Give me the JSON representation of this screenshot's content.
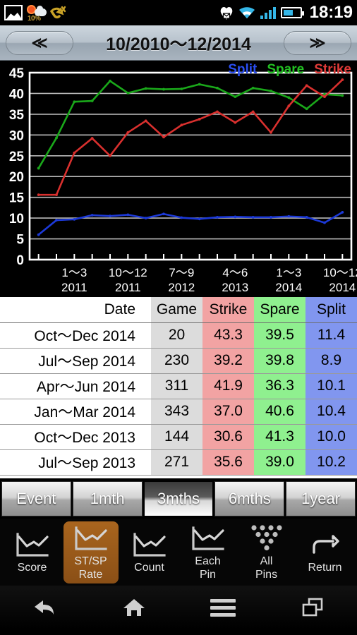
{
  "statusbar": {
    "time": "18:19",
    "weather_percent": "10%",
    "icons": [
      "gallery-icon",
      "weather-icon",
      "missed-call-icon",
      "message-heart-icon",
      "wifi-icon",
      "signal-icon",
      "battery-icon"
    ]
  },
  "titlebar": {
    "prev_label": "≪",
    "title": "10/2010～12/2014",
    "next_label": "≫"
  },
  "chart_data": {
    "type": "line",
    "title": "",
    "xlabel": "",
    "ylabel": "",
    "ylim": [
      0,
      45
    ],
    "yticks": [
      0,
      5,
      10,
      15,
      20,
      25,
      30,
      35,
      40,
      45
    ],
    "grid": true,
    "legend_position": "top-right",
    "xtick_labels": [
      {
        "index": 2,
        "line1": "1～3",
        "line2": "2011"
      },
      {
        "index": 5,
        "line1": "10～12",
        "line2": "2011"
      },
      {
        "index": 8,
        "line1": "7～9",
        "line2": "2012"
      },
      {
        "index": 11,
        "line1": "4～6",
        "line2": "2013"
      },
      {
        "index": 14,
        "line1": "1～3",
        "line2": "2014"
      },
      {
        "index": 17,
        "line1": "10～12",
        "line2": "2014"
      }
    ],
    "x_count": 18,
    "series": [
      {
        "name": "Split",
        "color": "#1c39d8",
        "values": [
          6.0,
          9.5,
          9.7,
          10.7,
          10.5,
          10.8,
          10.0,
          11.0,
          10.1,
          9.8,
          10.2,
          10.3,
          10.2,
          10.2,
          10.4,
          10.2,
          8.9,
          11.4
        ]
      },
      {
        "name": "Spare",
        "color": "#1aa81a",
        "values": [
          22.0,
          29.3,
          38.0,
          38.2,
          43.0,
          40.1,
          41.2,
          41.0,
          41.1,
          42.2,
          41.3,
          39.2,
          41.3,
          40.6,
          39.0,
          36.3,
          39.8,
          39.5
        ]
      },
      {
        "name": "Strike",
        "color": "#d9302e",
        "values": [
          15.6,
          15.6,
          25.7,
          29.2,
          25.0,
          30.6,
          33.4,
          29.5,
          32.4,
          33.8,
          35.6,
          33.0,
          35.6,
          30.6,
          37.0,
          41.9,
          39.2,
          43.3
        ]
      }
    ],
    "legend": [
      {
        "label": "Split",
        "color": "#2a4ef0"
      },
      {
        "label": "Spare",
        "color": "#22c022"
      },
      {
        "label": "Strike",
        "color": "#e03a38"
      }
    ]
  },
  "table": {
    "headers": [
      "Date",
      "Game",
      "Strike",
      "Spare",
      "Split"
    ],
    "rows": [
      {
        "date": "Oct～Dec 2014",
        "game": "20",
        "strike": "43.3",
        "spare": "39.5",
        "split": "11.4"
      },
      {
        "date": "Jul～Sep 2014",
        "game": "230",
        "strike": "39.2",
        "spare": "39.8",
        "split": "8.9"
      },
      {
        "date": "Apr～Jun 2014",
        "game": "311",
        "strike": "41.9",
        "spare": "36.3",
        "split": "10.1"
      },
      {
        "date": "Jan～Mar 2014",
        "game": "343",
        "strike": "37.0",
        "spare": "40.6",
        "split": "10.4"
      },
      {
        "date": "Oct～Dec 2013",
        "game": "144",
        "strike": "30.6",
        "spare": "41.3",
        "split": "10.0"
      },
      {
        "date": "Jul～Sep 2013",
        "game": "271",
        "strike": "35.6",
        "spare": "39.0",
        "split": "10.2"
      }
    ],
    "column_colors": {
      "game": "#dcdcdc",
      "strike": "#f2a3a3",
      "spare": "#8ff08f",
      "split": "#8196ef"
    }
  },
  "period_tabs": {
    "selected": "3mths",
    "items": [
      {
        "label": "Event"
      },
      {
        "label": "1mth"
      },
      {
        "label": "3mths"
      },
      {
        "label": "6mths"
      },
      {
        "label": "1year"
      }
    ]
  },
  "toolbar": {
    "selected": "ST/SP Rate",
    "accent": "#9b5c1a",
    "items": [
      {
        "label_line1": "Score",
        "label_line2": "",
        "icon": "line-chart-icon"
      },
      {
        "label_line1": "ST/SP",
        "label_line2": "Rate",
        "icon": "line-chart-icon"
      },
      {
        "label_line1": "Count",
        "label_line2": "",
        "icon": "line-chart-icon"
      },
      {
        "label_line1": "Each",
        "label_line2": "Pin",
        "icon": "line-chart-icon"
      },
      {
        "label_line1": "All",
        "label_line2": "Pins",
        "icon": "pin-layout-icon"
      },
      {
        "label_line1": "Return",
        "label_line2": "",
        "icon": "return-arrow-icon"
      }
    ]
  },
  "android_nav": {
    "items": [
      "back-icon",
      "home-icon",
      "menu-icon",
      "recent-apps-icon"
    ]
  }
}
